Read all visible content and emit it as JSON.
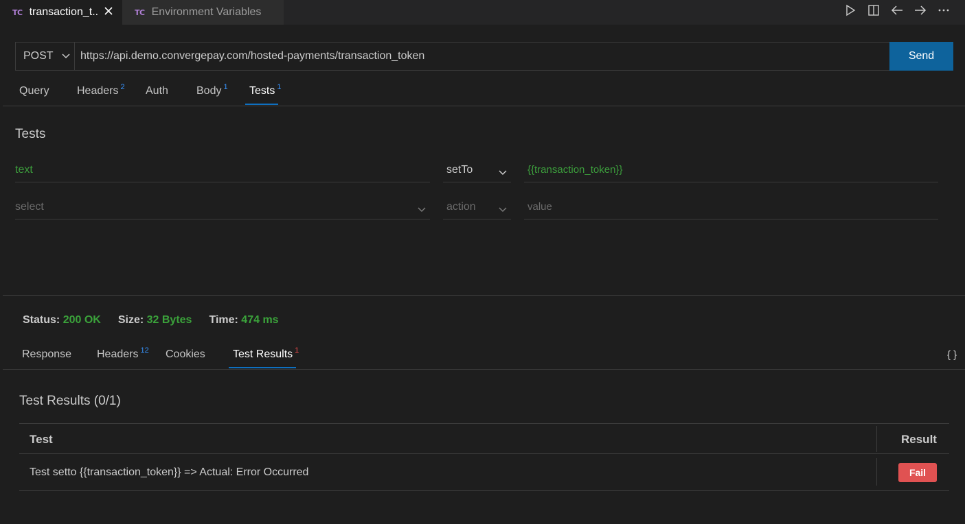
{
  "tabs": [
    {
      "icon": "TC",
      "label": "transaction_t..",
      "active": true
    },
    {
      "icon": "TC",
      "label": "Environment Variables",
      "active": false
    }
  ],
  "request": {
    "method": "POST",
    "url": "https://api.demo.convergepay.com/hosted-payments/transaction_token",
    "send_label": "Send"
  },
  "request_tabs": [
    {
      "label": "Query",
      "count": ""
    },
    {
      "label": "Headers",
      "count": "2"
    },
    {
      "label": "Auth",
      "count": ""
    },
    {
      "label": "Body",
      "count": "1"
    },
    {
      "label": "Tests",
      "count": "1"
    }
  ],
  "tests": {
    "title": "Tests",
    "rows": [
      {
        "field": "text",
        "action": "setTo",
        "value": "{{transaction_token}}"
      }
    ],
    "new_row": {
      "field_placeholder": "select",
      "action_placeholder": "action",
      "value_placeholder": "value"
    }
  },
  "status": {
    "status_label": "Status:",
    "status_value": "200 OK",
    "size_label": "Size:",
    "size_value": "32 Bytes",
    "time_label": "Time:",
    "time_value": "474 ms",
    "value_color": "#3ba33b"
  },
  "response_tabs": [
    {
      "label": "Response",
      "count": ""
    },
    {
      "label": "Headers",
      "count": "12"
    },
    {
      "label": "Cookies",
      "count": ""
    },
    {
      "label": "Test Results",
      "count": "1"
    }
  ],
  "format_icon": "{ }",
  "results": {
    "title": "Test Results (0/1)",
    "columns": [
      "Test",
      "Result"
    ],
    "rows": [
      {
        "test": "Test setto {{transaction_token}} => Actual: Error Occurred",
        "result": "Fail"
      }
    ]
  },
  "colors": {
    "accent": "#0e639c",
    "fail": "#e05252",
    "success": "#3ba33b",
    "badge_count": "#3794ff",
    "tc_icon": "#b180d7"
  }
}
